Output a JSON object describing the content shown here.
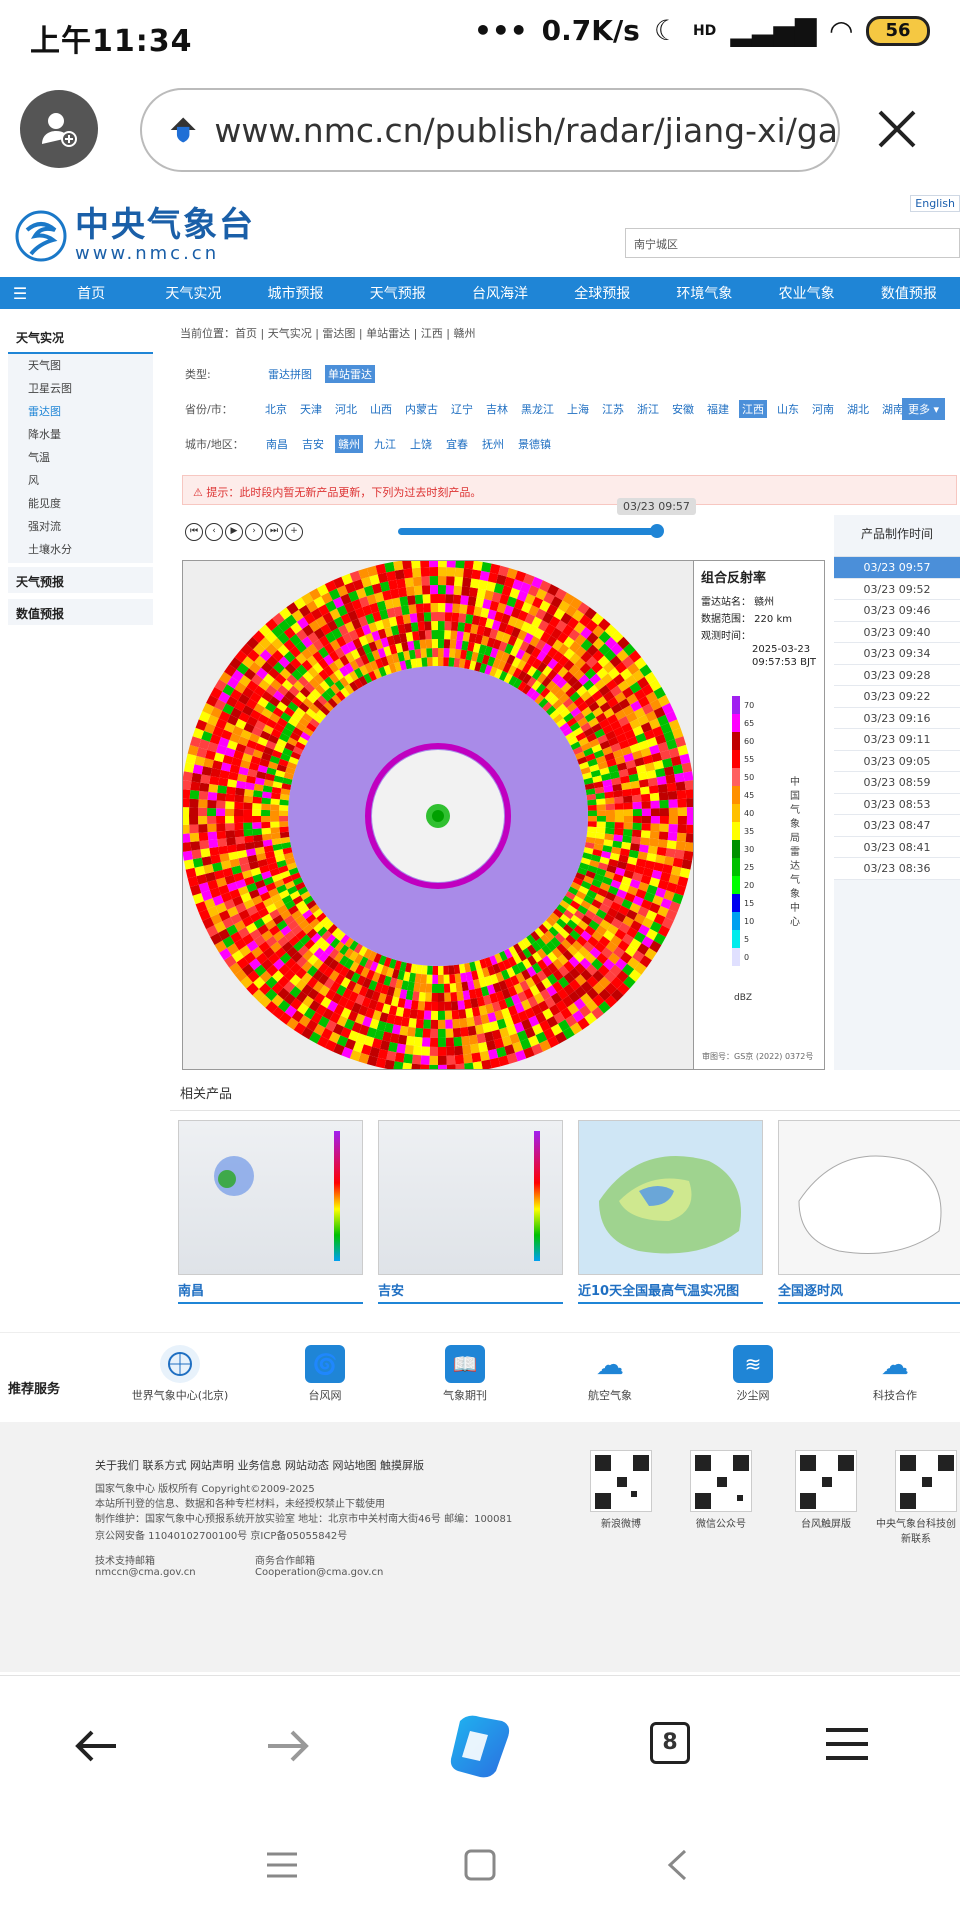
{
  "status_bar": {
    "time": "上午11:34",
    "speed": "0.7K/s",
    "battery": "56",
    "hd": "HD"
  },
  "browser": {
    "url": "www.nmc.cn/publish/radar/jiang-xi/ga",
    "tab_count": "8"
  },
  "site": {
    "english": "English",
    "logo_name": "中央气象台",
    "logo_url": "www.nmc.cn",
    "search_value": "南宁城区",
    "nav": [
      "首页",
      "天气实况",
      "城市预报",
      "天气预报",
      "台风海洋",
      "全球预报",
      "环境气象",
      "农业气象",
      "数值预报"
    ],
    "sidebar": {
      "head": "天气实况",
      "items": [
        "天气图",
        "卫星云图",
        "雷达图",
        "降水量",
        "气温",
        "风",
        "能见度",
        "强对流",
        "土壤水分"
      ],
      "head2": "天气预报",
      "head3": "数值预报"
    },
    "breadcrumb": "当前位置：首页 | 天气实况 | 雷达图 | 单站雷达 | 江西 | 赣州",
    "type_label": "类型:",
    "type_options": [
      "雷达拼图",
      "单站雷达"
    ],
    "province_label": "省份/市：",
    "provinces": [
      "北京",
      "天津",
      "河北",
      "山西",
      "内蒙古",
      "辽宁",
      "吉林",
      "黑龙江",
      "上海",
      "江苏",
      "浙江",
      "安徽",
      "福建",
      "江西",
      "山东",
      "河南",
      "湖北",
      "湖南"
    ],
    "more_label": "更多 ▾",
    "city_label": "城市/地区：",
    "cities": [
      "南昌",
      "吉安",
      "赣州",
      "九江",
      "上饶",
      "宜春",
      "抚州",
      "景德镇"
    ],
    "notice": "⚠ 提示：此时段内暂无新产品更新，下列为过去时刻产品。",
    "slider_tooltip": "03/23 09:57",
    "time_panel_title": "产品制作时间",
    "times": [
      "03/23 09:57",
      "03/23 09:52",
      "03/23 09:46",
      "03/23 09:40",
      "03/23 09:34",
      "03/23 09:28",
      "03/23 09:22",
      "03/23 09:16",
      "03/23 09:11",
      "03/23 09:05",
      "03/23 08:59",
      "03/23 08:53",
      "03/23 08:47",
      "03/23 08:41",
      "03/23 08:36"
    ],
    "radar": {
      "title": "组合反射率",
      "station": "雷达站名：   赣州",
      "range": "数据范围：   220 km",
      "obs_label": "观测时间：",
      "obs_date": "2025-03-23",
      "obs_time": "09:57:53 BJT",
      "vertical_text": "中国气象局雷达气象中心",
      "unit": "dBZ",
      "approval": "审图号：GS京 (2022) 0372号",
      "scale_labels": [
        "70",
        "65",
        "60",
        "55",
        "50",
        "45",
        "40",
        "35",
        "30",
        "25",
        "20",
        "15",
        "10",
        "5",
        "0"
      ],
      "scale_colors": [
        "#a020f0",
        "#ff00ff",
        "#c00000",
        "#ff0000",
        "#ff6060",
        "#ff9000",
        "#ffc000",
        "#ffff00",
        "#009000",
        "#00c000",
        "#00ff00",
        "#0000f0",
        "#00a0f0",
        "#00ecec",
        "#e0e0ff"
      ]
    },
    "related": {
      "title": "相关产品",
      "items": [
        "南昌",
        "吉安",
        "近10天全国最高气温实况图",
        "全国逐时风"
      ]
    },
    "services": {
      "title": "推荐服务",
      "items": [
        "世界气象中心(北京)",
        "台风网",
        "气象期刊",
        "航空气象",
        "沙尘网",
        "科技合作"
      ]
    },
    "footer": {
      "links": "关于我们  联系方式  网站声明  业务信息  网站动态  网站地图  触摸屏版",
      "copyright": "国家气象中心 版权所有 Copyright©2009-2025",
      "rights": "本站所刊登的信息、数据和各种专栏材料，未经授权禁止下载使用",
      "maker": "制作维护：国家气象中心预报系统开放实验室 地址：北京市中关村南大街46号 邮编：100081",
      "icp": "京公网安备 11040102700100号   京ICP备05055842号",
      "tech_label": "技术支持邮箱",
      "tech_mail": "nmccn@cma.gov.cn",
      "biz_label": "商务合作邮箱",
      "biz_mail": "Cooperation@cma.gov.cn",
      "qr_labels": [
        "新浪微博",
        "微信公众号",
        "台风触屏版",
        "中央气象台科技创新联系"
      ]
    }
  }
}
